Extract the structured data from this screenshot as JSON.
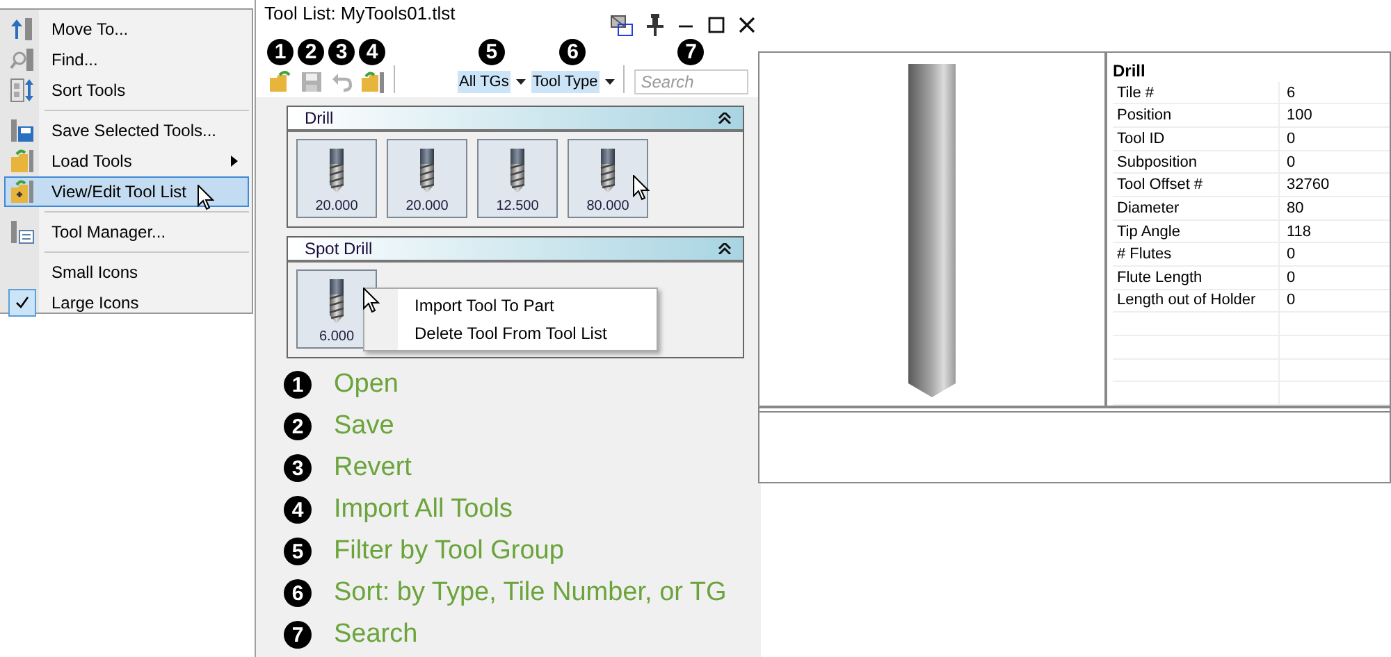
{
  "menu": {
    "groups": [
      [
        {
          "label": "Move To...",
          "selected": false,
          "checked": false,
          "has_submenu": false
        },
        {
          "label": "Find...",
          "selected": false,
          "checked": false,
          "has_submenu": false
        },
        {
          "label": "Sort Tools",
          "selected": false,
          "checked": false,
          "has_submenu": false
        }
      ],
      [
        {
          "label": "Save Selected Tools...",
          "selected": false,
          "checked": false,
          "has_submenu": false
        },
        {
          "label": "Load Tools",
          "selected": false,
          "checked": false,
          "has_submenu": true
        },
        {
          "label": "View/Edit Tool List",
          "selected": true,
          "checked": false,
          "has_submenu": false
        }
      ],
      [
        {
          "label": "Tool Manager...",
          "selected": false,
          "checked": false,
          "has_submenu": false
        }
      ],
      [
        {
          "label": "Small Icons",
          "selected": false,
          "checked": false,
          "has_submenu": false
        },
        {
          "label": "Large Icons",
          "selected": false,
          "checked": true,
          "has_submenu": false
        }
      ]
    ]
  },
  "tool_list": {
    "title": "Tool List: MyTools01.tlst",
    "toolbar": {
      "buttons": [
        {
          "callout": "1",
          "disabled": false
        },
        {
          "callout": "2",
          "disabled": true
        },
        {
          "callout": "3",
          "disabled": true
        },
        {
          "callout": "4",
          "disabled": false
        }
      ],
      "dropdowns": [
        {
          "callout": "5",
          "value": "All TGs"
        },
        {
          "callout": "6",
          "value": "Tool Type"
        }
      ],
      "search": {
        "callout": "7",
        "placeholder": "Search"
      }
    },
    "groups": [
      {
        "name": "Drill",
        "expanded": true,
        "tiles": [
          "20.000",
          "20.000",
          "12.500",
          "80.000"
        ]
      },
      {
        "name": "Spot Drill",
        "expanded": true,
        "tiles": [
          "6.000"
        ]
      }
    ],
    "context_menu": [
      "Import Tool To Part",
      "Delete Tool From Tool List"
    ],
    "legend": [
      {
        "number": "1",
        "text": "Open"
      },
      {
        "number": "2",
        "text": "Save"
      },
      {
        "number": "3",
        "text": "Revert"
      },
      {
        "number": "4",
        "text": "Import All Tools"
      },
      {
        "number": "5",
        "text": "Filter by Tool Group"
      },
      {
        "number": "6",
        "text": "Sort: by Type, Tile Number, or TG"
      },
      {
        "number": "7",
        "text": "Search"
      }
    ]
  },
  "details": {
    "title": "Drill",
    "properties": [
      {
        "name": "Tile #",
        "value": "6"
      },
      {
        "name": "Position",
        "value": "100"
      },
      {
        "name": "Tool ID",
        "value": "0"
      },
      {
        "name": "Subposition",
        "value": "0"
      },
      {
        "name": "Tool Offset #",
        "value": "32760"
      },
      {
        "name": "Diameter",
        "value": "80"
      },
      {
        "name": "Tip Angle",
        "value": "118"
      },
      {
        "name": "# Flutes",
        "value": "0"
      },
      {
        "name": "Flute Length",
        "value": "0"
      },
      {
        "name": "Length out of Holder",
        "value": "0"
      }
    ]
  }
}
